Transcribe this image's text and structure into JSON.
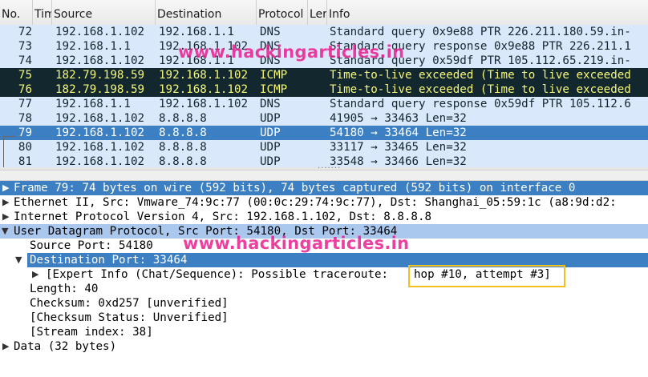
{
  "columns": {
    "no": "No.",
    "time": "Tim",
    "source": "Source",
    "destination": "Destination",
    "protocol": "Protocol",
    "length": "Ler",
    "info": "Info"
  },
  "packets": [
    {
      "no": "72",
      "source": "192.168.1.102",
      "destination": "192.168.1.1",
      "protocol": "DNS",
      "info": "Standard query 0x9e88 PTR 226.211.180.59.in-"
    },
    {
      "no": "73",
      "source": "192.168.1.1",
      "destination": "192.168.1.102",
      "protocol": "DNS",
      "info": "Standard query response 0x9e88 PTR 226.211.1"
    },
    {
      "no": "74",
      "source": "192.168.1.102",
      "destination": "192.168.1.1",
      "protocol": "DNS",
      "info": "Standard query 0x59df PTR 105.112.65.219.in-"
    },
    {
      "no": "75",
      "source": "182.79.198.59",
      "destination": "192.168.1.102",
      "protocol": "ICMP",
      "info": "Time-to-live exceeded (Time to live exceeded"
    },
    {
      "no": "76",
      "source": "182.79.198.59",
      "destination": "192.168.1.102",
      "protocol": "ICMP",
      "info": "Time-to-live exceeded (Time to live exceeded"
    },
    {
      "no": "77",
      "source": "192.168.1.1",
      "destination": "192.168.1.102",
      "protocol": "DNS",
      "info": "Standard query response 0x59df PTR 105.112.6"
    },
    {
      "no": "78",
      "source": "192.168.1.102",
      "destination": "8.8.8.8",
      "protocol": "UDP",
      "info": "41905 → 33463 Len=32"
    },
    {
      "no": "79",
      "source": "192.168.1.102",
      "destination": "8.8.8.8",
      "protocol": "UDP",
      "info": "54180 → 33464 Len=32"
    },
    {
      "no": "80",
      "source": "192.168.1.102",
      "destination": "8.8.8.8",
      "protocol": "UDP",
      "info": "33117 → 33465 Len=32"
    },
    {
      "no": "81",
      "source": "192.168.1.102",
      "destination": "8.8.8.8",
      "protocol": "UDP",
      "info": "33548 → 33466 Len=32"
    }
  ],
  "details": {
    "frame": "Frame 79: 74 bytes on wire (592 bits), 74 bytes captured (592 bits) on interface 0",
    "ethernet": "Ethernet II, Src: Vmware_74:9c:77 (00:0c:29:74:9c:77), Dst: Shanghai_05:59:1c (a8:9d:d2:",
    "ip": "Internet Protocol Version 4, Src: 192.168.1.102, Dst: 8.8.8.8",
    "udp": "User Datagram Protocol, Src Port: 54180, Dst Port: 33464",
    "src_port": "Source Port: 54180",
    "dst_port": "Destination Port: 33464",
    "expert_prefix": "[Expert Info (Chat/Sequence): Possible traceroute: ",
    "expert_highlight": "hop #10, attempt #3]",
    "length": "Length: 40",
    "checksum": "Checksum: 0xd257 [unverified]",
    "checksum_status": "[Checksum Status: Unverified]",
    "stream_index": "[Stream index: 38]",
    "data": "Data (32 bytes)"
  },
  "watermark": "www.hackingarticles.in",
  "colors": {
    "udp_row_bg": "#dae8fc",
    "dns_row_bg": "#dae8fc",
    "icmp_row_bg": "#12272e",
    "icmp_row_fg": "#f7f779",
    "selected_bg": "#3c7fc2",
    "detail_selected_bg": "#3c7fc2",
    "watermark": "#e8178d",
    "highlight_box": "#f3c021"
  },
  "icons": {
    "collapsed": "triangle-right-icon",
    "expanded": "triangle-down-icon"
  }
}
